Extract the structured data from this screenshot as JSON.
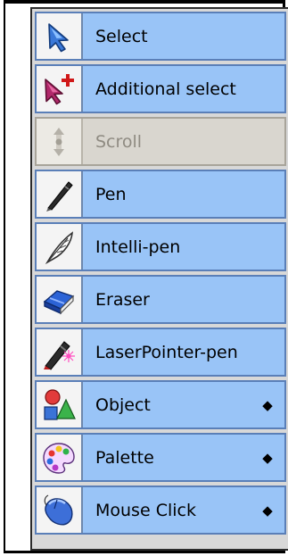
{
  "menu": {
    "items": [
      {
        "label": "Select",
        "icon": "arrow-cursor-icon",
        "enabled": true,
        "has_submenu": false
      },
      {
        "label": "Additional select",
        "icon": "arrow-cursor-plus-icon",
        "enabled": true,
        "has_submenu": false
      },
      {
        "label": "Scroll",
        "icon": "scroll-arrows-icon",
        "enabled": false,
        "has_submenu": false
      },
      {
        "label": "Pen",
        "icon": "pen-icon",
        "enabled": true,
        "has_submenu": false
      },
      {
        "label": "Intelli-pen",
        "icon": "feather-pen-icon",
        "enabled": true,
        "has_submenu": false
      },
      {
        "label": "Eraser",
        "icon": "eraser-icon",
        "enabled": true,
        "has_submenu": false
      },
      {
        "label": "LaserPointer-pen",
        "icon": "laser-pointer-icon",
        "enabled": true,
        "has_submenu": false
      },
      {
        "label": "Object",
        "icon": "shapes-icon",
        "enabled": true,
        "has_submenu": true
      },
      {
        "label": "Palette",
        "icon": "palette-icon",
        "enabled": true,
        "has_submenu": true
      },
      {
        "label": "Mouse Click",
        "icon": "mouse-icon",
        "enabled": true,
        "has_submenu": true
      }
    ],
    "submenu_glyph": "◆"
  },
  "colors": {
    "item_background": "#99c4f7",
    "item_border": "#5a7fb8",
    "disabled_background": "#d9d6cf",
    "disabled_text": "#8f8b82"
  }
}
